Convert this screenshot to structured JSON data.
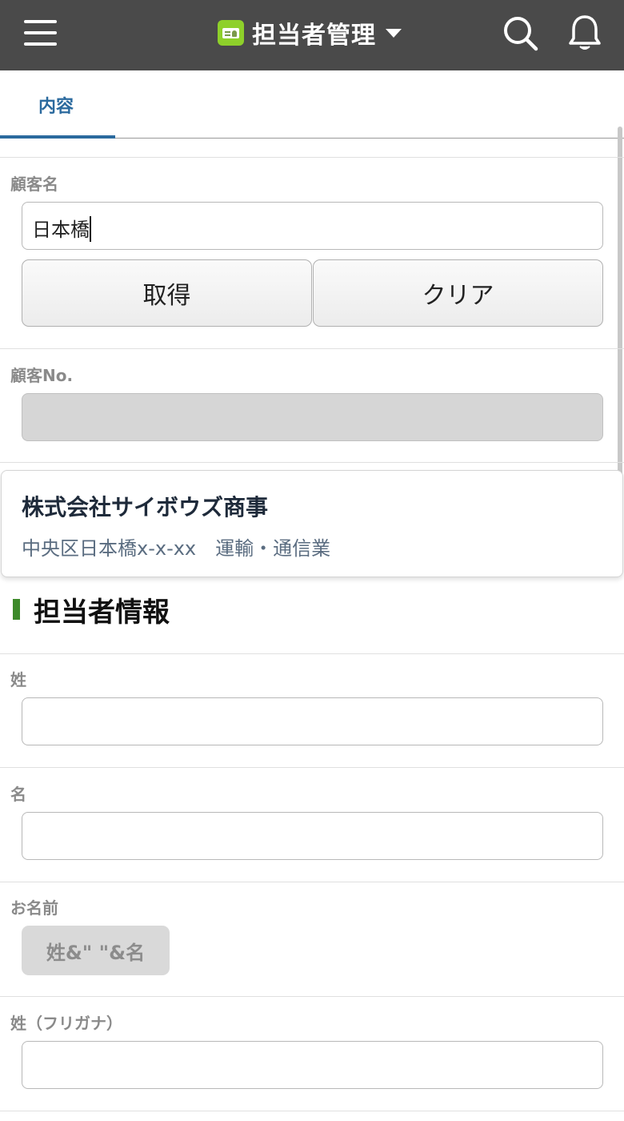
{
  "header": {
    "title": "担当者管理",
    "menu_icon": "hamburger-menu-icon",
    "search_icon": "search-icon",
    "notification_icon": "bell-icon"
  },
  "tabs": [
    {
      "label": "内容",
      "active": true
    }
  ],
  "form": {
    "customer_name": {
      "label": "顧客名",
      "value": "日本橋"
    },
    "buttons": {
      "fetch": "取得",
      "clear": "クリア"
    },
    "customer_no": {
      "label": "顧客No.",
      "value": ""
    }
  },
  "lookup_result": {
    "company": "株式会社サイボウズ商事",
    "detail": "中央区日本橋x-x-xx　運輸・通信業"
  },
  "section": {
    "title": "担当者情報"
  },
  "fields": {
    "last_name": {
      "label": "姓",
      "value": ""
    },
    "first_name": {
      "label": "名",
      "value": ""
    },
    "full_name": {
      "label": "お名前",
      "formula": "姓&\" \"&名"
    },
    "last_name_kana": {
      "label": "姓（フリガナ）",
      "value": ""
    }
  },
  "colors": {
    "header_bg": "#4a4a4a",
    "tab_accent": "#2b6a9e",
    "section_accent": "#3d8a2a",
    "app_icon": "#8ed02a"
  }
}
